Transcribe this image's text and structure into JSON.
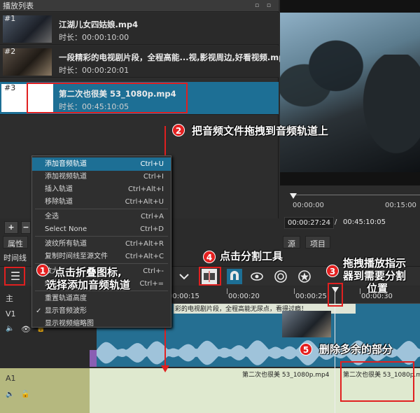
{
  "playlist": {
    "title": "播放列表",
    "title_icons": "▫ ▫",
    "items": [
      {
        "num": "#1",
        "name": "江湖儿女四姑娘.mp4",
        "duration": "时长：00:00:10:00"
      },
      {
        "num": "#2",
        "name": "一段精彩的电视剧片段，全程高能...视,影视周边,好看视频.mp4",
        "duration": "时长：00:00:20:01"
      },
      {
        "num": "#3",
        "name": "第二次也很美 53_1080p.mp4",
        "duration": "时长：00:45:10:05"
      }
    ]
  },
  "preview": {
    "ruler_start": "00:00:00",
    "ruler_mid": "00:15:00",
    "current_time": "00:00:27:24",
    "separator": "/",
    "total_time": "00:45:10:05"
  },
  "toolbar": {
    "add": "+",
    "minus": "−"
  },
  "tabs": {
    "properties": "属性",
    "source": "源",
    "project": "项目"
  },
  "timeline": {
    "title": "时间线",
    "menu_icon": "☰",
    "ruler": [
      "00:00:15",
      "00:00:20",
      "00:00:25",
      "00:00:30"
    ],
    "tracks": {
      "master": "主",
      "v1": "V1",
      "a1": "A1"
    },
    "v1_clip_label": "彩的电视剧片段，全程高能无尿点，看得过瘾！",
    "a1_clip_label_1": "第二次也很美 53_1080p.mp4",
    "a1_clip_label_2": "第二次也很美 53_1080p.mp4"
  },
  "context_menu": {
    "items": [
      {
        "label": "添加音频轨道",
        "shortcut": "Ctrl+U",
        "highlight": true
      },
      {
        "label": "添加视频轨道",
        "shortcut": "Ctrl+I"
      },
      {
        "label": "插入轨道",
        "shortcut": "Ctrl+Alt+I"
      },
      {
        "label": "移除轨道",
        "shortcut": "Ctrl+Alt+U"
      },
      {
        "label": "全选",
        "shortcut": "Ctrl+A"
      },
      {
        "label": "Select None",
        "shortcut": "Ctrl+D"
      },
      {
        "label": "波纹所有轨道",
        "shortcut": "Ctrl+Alt+R"
      },
      {
        "label": "复制时间线至源文件",
        "shortcut": "Ctrl+Alt+C"
      },
      {
        "label": "放大",
        "shortcut": "Ctrl+-"
      },
      {
        "label": "缩小",
        "shortcut": "Ctrl+="
      },
      {
        "label": "重置轨道高度",
        "shortcut": ""
      },
      {
        "label": "显示音频波形",
        "shortcut": "",
        "checked": true
      },
      {
        "label": "显示视频缩略图",
        "shortcut": ""
      }
    ],
    "check_mark": "✓"
  },
  "annotations": {
    "a1_num": "1",
    "a1_text_l1": "点击折叠图标,",
    "a1_text_l2": "选择添加音频轨道",
    "a2_num": "2",
    "a2_text": "把音频文件拖拽到音频轨道上",
    "a3_num": "3",
    "a3_text_l1": "拖拽播放指示",
    "a3_text_l2": "器到需要分割",
    "a3_text_l3": "位置",
    "a4_num": "4",
    "a4_text": "点击分割工具",
    "a5_num": "5",
    "a5_text": "删除多余的部分"
  },
  "colors": {
    "selection": "#1d6f95",
    "annotation_red": "#e02020",
    "audio_track": "#dfe9cf"
  }
}
